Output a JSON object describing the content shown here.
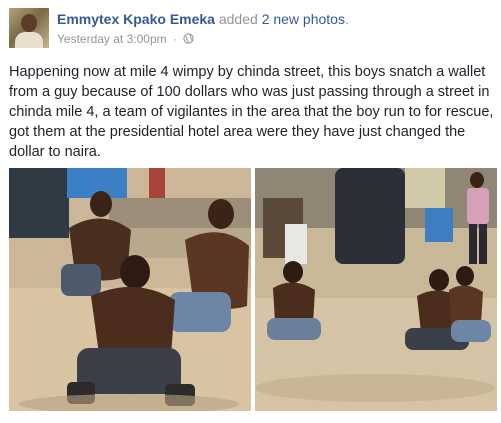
{
  "post": {
    "author": "Emmytex Kpako Emeka",
    "action_prefix": "added",
    "action_link": "2 new photos",
    "action_suffix": ".",
    "timestamp": "Yesterday at 3:00pm",
    "separator": "·",
    "privacy_icon": "globe-icon",
    "text": "Happening now at mile 4 wimpy by chinda street, this boys snatch a wallet from a guy because of 100 dollars who was just passing through a street in chinda mile 4, a team of vigilantes in the area that the boy run to for rescue, got them at the presidential hotel area were they have just changed the dollar to naira."
  },
  "photos": [
    {
      "name": "photo-1"
    },
    {
      "name": "photo-2"
    }
  ],
  "colors": {
    "link": "#365899",
    "secondary_text": "#90949c",
    "body_text": "#1d2129"
  }
}
